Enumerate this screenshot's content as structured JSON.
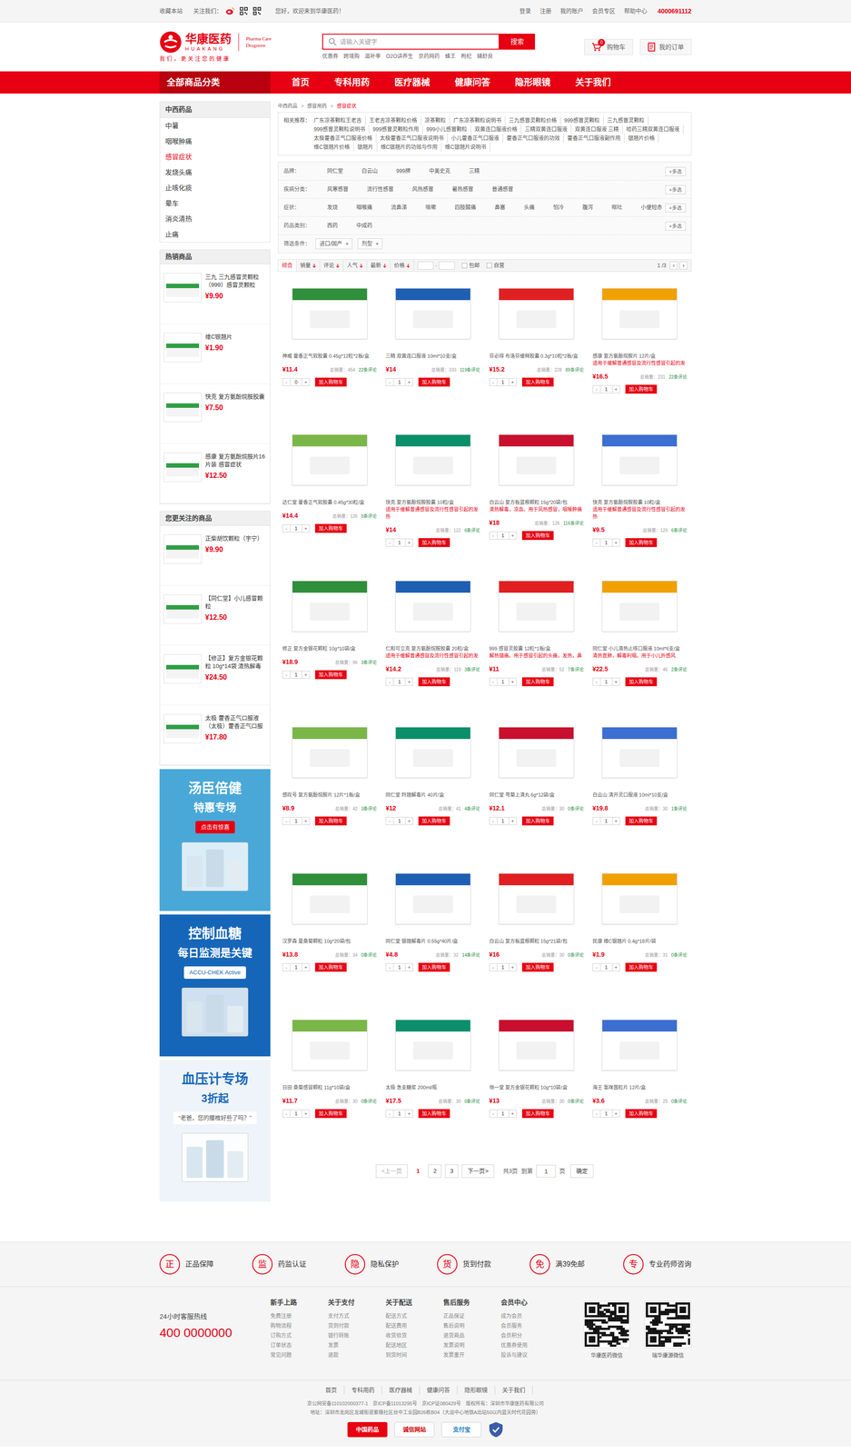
{
  "topbar": {
    "bookmark": "收藏本站",
    "follow": "关注我们：",
    "greeting": "您好，欢迎来到华康医药！",
    "links": [
      "登录",
      "注册",
      "我的账户",
      "会员专区",
      "帮助中心"
    ],
    "phone": "4000691112"
  },
  "logo": {
    "cn": "华康医药",
    "en": "HUAKANG",
    "tag1": "Pharma Care",
    "tag2": "Drugstore",
    "slogan": "我们，更关注您的健康"
  },
  "search": {
    "placeholder": "请输入关键字",
    "button": "搜索",
    "hot": [
      "优惠券",
      "跨境购",
      "滋补季",
      "O2O讲养生",
      "京药网药",
      "蜂王",
      "枸杞",
      "辅舒良"
    ]
  },
  "cart": {
    "label": "购物车",
    "count": "0"
  },
  "orders": {
    "label": "我的订单"
  },
  "nav": {
    "all": "全部商品分类",
    "items": [
      {
        "label": "首页",
        "selected": false
      },
      {
        "label": "专科用药",
        "selected": false
      },
      {
        "label": "医疗器械",
        "selected": false
      },
      {
        "label": "健康问答",
        "selected": false
      },
      {
        "label": "隐形眼镜",
        "selected": false
      },
      {
        "label": "关于我们",
        "selected": false
      }
    ]
  },
  "sidebar": {
    "category": {
      "title": "中西药品",
      "items": [
        {
          "label": "中暑",
          "selected": false
        },
        {
          "label": "咽喉肿痛",
          "selected": false
        },
        {
          "label": "感冒症状",
          "selected": true
        },
        {
          "label": "发烧头痛",
          "selected": false
        },
        {
          "label": "止咳化痰",
          "selected": false
        },
        {
          "label": "晕车",
          "selected": false
        },
        {
          "label": "消炎清热",
          "selected": false
        },
        {
          "label": "止痛",
          "selected": false
        }
      ]
    },
    "hot": {
      "title": "热销商品",
      "items": [
        {
          "name": "三九 三九感冒灵颗粒（999）感冒灵颗粒",
          "price": "¥9.90"
        },
        {
          "name": "维C银翘片",
          "price": "¥1.90"
        },
        {
          "name": "快克 复方氨酚烷胺胶囊",
          "price": "¥7.50"
        },
        {
          "name": "感康 复方氨酚烷胺片16片装 感冒症状",
          "price": "¥12.50"
        }
      ]
    },
    "care": {
      "title": "您更关注的商品",
      "items": [
        {
          "name": "正柴胡饮颗粒（宇宁）",
          "price": "¥9.90"
        },
        {
          "name": "【同仁堂】小儿感冒颗粒",
          "price": "¥12.50"
        },
        {
          "name": "【修正】复方金银花颗粒 10g*14袋 清热解毒",
          "price": "¥24.50"
        },
        {
          "name": "太极 藿香正气口服液（太极）藿香正气口服",
          "price": "¥17.80"
        }
      ]
    },
    "banners": [
      {
        "title": "汤臣倍健",
        "subtitle": "特惠专场",
        "action": "点击有惊喜"
      },
      {
        "title": "控制血糖",
        "subtitle": "每日监测是关键",
        "action": "ACCU-CHEK Active"
      },
      {
        "title": "血压计专场",
        "subtitle": "3折起",
        "action": "“老爸，您的腰椎好些了吗？”"
      }
    ]
  },
  "breadcrumb": {
    "items": [
      "中西药品",
      "感冒用药",
      "感冒症状"
    ],
    "sep": ">"
  },
  "related": {
    "label": "相关推荐：",
    "links": [
      "广东凉茶颗粒王老吉",
      "王老吉凉茶颗粒价格",
      "凉茶颗粒",
      "广东凉茶颗粒说明书",
      "三九感冒灵颗粒价格",
      "999感冒灵颗粒",
      "三九感冒灵颗粒",
      "999感冒灵颗粒说明书",
      "999感冒灵颗粒作用",
      "999小儿感冒颗粒",
      "双黄连口服液价格",
      "三精双黄连口服液",
      "双黄连口服液 三精",
      "哈药三精双黄连口服液",
      "太极藿香正气口服液价格",
      "太极藿香正气口服液说明书",
      "小儿藿香正气口服液",
      "藿香正气口服液的功效",
      "藿香正气口服液副作用",
      "银翘片价格",
      "维C银翘片价格",
      "银翘片",
      "维C银翘片的功效与作用",
      "维C银翘片说明书"
    ]
  },
  "filters": {
    "rows": [
      {
        "label": "品牌：",
        "options": [
          "同仁堂",
          "白云山",
          "999牌",
          "中美史克",
          "三精"
        ],
        "more": "+多选"
      },
      {
        "label": "疾病分类：",
        "options": [
          "风寒感冒",
          "流行性感冒",
          "风热感冒",
          "暑热感冒",
          "普通感冒"
        ],
        "more": "+多选"
      },
      {
        "label": "症状：",
        "options": [
          "发烧",
          "咽喉痛",
          "流鼻涕",
          "咳嗽",
          "四肢酸痛",
          "鼻塞",
          "头痛",
          "怕冷",
          "腹泻",
          "呕吐",
          "小便短赤"
        ],
        "more": "+多选"
      },
      {
        "label": "药品类别：",
        "options": [
          "西药",
          "中成药"
        ],
        "more": "+多选"
      }
    ],
    "conditions": {
      "label": "筛选条件：",
      "selects": [
        "进口/国产",
        "剂型"
      ],
      "arrow": "▾"
    }
  },
  "sort": {
    "items": [
      {
        "label": "综合",
        "selected": true
      },
      {
        "label": "销量",
        "selected": false
      },
      {
        "label": "评论",
        "selected": false
      },
      {
        "label": "人气",
        "selected": false
      },
      {
        "label": "最新",
        "selected": false
      },
      {
        "label": "价格",
        "selected": false
      }
    ],
    "range_sep": "-",
    "checks": [
      {
        "label": "包邮",
        "checked": false
      },
      {
        "label": "自营",
        "checked": false
      }
    ],
    "page": "1 /3",
    "prev": "‹",
    "next": "›"
  },
  "products": {
    "add": "加入购物车",
    "minus": "-",
    "plus": "+",
    "items": [
      {
        "name": "神威 藿香正气软胶囊 0.45g*12粒*2板/盒",
        "price": "¥11.4",
        "sales": "总销量：454",
        "reviews": "22条评论",
        "qty": "0"
      },
      {
        "name": "三精 双黄连口服液 10ml*10支/盒",
        "price": "¥14",
        "sales": "总销量：333",
        "reviews": "119条评论",
        "qty": "1"
      },
      {
        "name": "芬必得 布洛芬缓释胶囊 0.3g*10粒*2板/盒",
        "price": "¥15.2",
        "sales": "总销量：228",
        "reviews": "89条评论",
        "qty": "1"
      },
      {
        "name": "感康 复方氨酚烷胺片 12片/盒",
        "desc": "适用于缓解普通感冒及流行性感冒引起的发",
        "price": "¥16.5",
        "sales": "总销量：231",
        "reviews": "22条评论",
        "qty": "1"
      },
      {
        "name": "达仁堂 藿香正气软胶囊 0.45g*30粒/盒",
        "price": "¥14.4",
        "sales": "总销量：126",
        "reviews": "5条评论",
        "qty": "1"
      },
      {
        "name": "快克 复方氨酚烷胺胶囊 10粒/盒",
        "desc": "适用于缓解普通感冒及流行性感冒引起的发热",
        "price": "¥14",
        "sales": "总销量：122",
        "reviews": "6条评论",
        "qty": "1"
      },
      {
        "name": "白云山 复方板蓝根颗粒 15g*20袋/包",
        "desc": "清热解毒，凉血。用于风热感冒，咽喉肿痛",
        "price": "¥18",
        "sales": "总销量：126",
        "reviews": "116条评论",
        "qty": "1"
      },
      {
        "name": "快克 复方氨酚烷胺胶囊 10粒/盒",
        "desc": "适用于缓解普通感冒及流行性感冒引起的发热",
        "price": "¥9.5",
        "sales": "总销量：129",
        "reviews": "6条评论",
        "qty": "1"
      },
      {
        "name": "修正 复方金银花颗粒 10g*10袋/盒",
        "price": "¥18.9",
        "sales": "总销量：96",
        "reviews": "3条评论",
        "qty": "1"
      },
      {
        "name": "仁和可立克 复方氨酚烷胺胶囊 20粒/盒",
        "desc": "适用于缓解普通感冒及流行性感冒引起的发",
        "price": "¥14.2",
        "sales": "总销量：119",
        "reviews": "3条评论",
        "qty": "1"
      },
      {
        "name": "999 感冒灵胶囊 12粒*1板/盒",
        "desc": "解热镇痛。用于感冒引起的头痛，发热，鼻",
        "price": "¥11",
        "sales": "总销量：52",
        "reviews": "7条评论",
        "qty": "1"
      },
      {
        "name": "同仁堂 小儿清热止咳口服液 10ml*6支/盒",
        "desc": "清热宣肺，解毒利咽。用于小儿外感风",
        "price": "¥22.5",
        "sales": "总销量：46",
        "reviews": "2条评论",
        "qty": "1"
      },
      {
        "name": "感叹号 复方氨酚烷胺片 12片*1板/盒",
        "price": "¥8.9",
        "sales": "总销量：42",
        "reviews": "3条评论",
        "qty": "1"
      },
      {
        "name": "同仁堂 羚翘解毒片 40片/盒",
        "price": "¥12",
        "sales": "总销量：41",
        "reviews": "4条评论",
        "qty": "1"
      },
      {
        "name": "同仁堂 芎菊上清丸 6g*12袋/盒",
        "price": "¥12.1",
        "sales": "总销量：30",
        "reviews": "0条评论",
        "qty": "1"
      },
      {
        "name": "白云山 清开灵口服液 10ml*10支/盒",
        "price": "¥19.8",
        "sales": "总销量：30",
        "reviews": "1条评论",
        "qty": "1"
      },
      {
        "name": "汉罗森 夏桑菊颗粒 10g*20袋/包",
        "price": "¥13.8",
        "sales": "总销量：34",
        "reviews": "0条评论",
        "qty": "1"
      },
      {
        "name": "同仁堂 银翘解毒片 0.55g*40片/盒",
        "price": "¥4.8",
        "sales": "总销量：32",
        "reviews": "14条评论",
        "qty": "1"
      },
      {
        "name": "白云山 复方板蓝根颗粒 15g*21袋/包",
        "price": "¥16",
        "sales": "总销量：30",
        "reviews": "0条评论",
        "qty": "1"
      },
      {
        "name": "民康 维C银翘片 0.4g*18片/袋",
        "price": "¥1.9",
        "sales": "总销量：31",
        "reviews": "0条评论",
        "qty": "1"
      },
      {
        "name": "日田 桑菊感冒颗粒 11g*10袋/盒",
        "price": "¥11.7",
        "sales": "总销量：30",
        "reviews": "0条评论",
        "qty": "1"
      },
      {
        "name": "太极 急支糖浆 200ml/瓶",
        "price": "¥17.5",
        "sales": "总销量：30",
        "reviews": "0条评论",
        "qty": "1"
      },
      {
        "name": "恒一堂 复方金银花颗粒 10g*10袋/盒",
        "price": "¥13",
        "sales": "总销量：30",
        "reviews": "0条评论",
        "qty": "1"
      },
      {
        "name": "海王 氯咪茵粒片 12片/盒",
        "price": "¥3.6",
        "sales": "总销量：25",
        "reviews": "0条评论",
        "qty": "1"
      }
    ]
  },
  "pagination": {
    "prev": {
      "label": "<上一页",
      "disabled": true
    },
    "pages": [
      {
        "label": "1",
        "selected": true
      },
      {
        "label": "2",
        "selected": false
      },
      {
        "label": "3",
        "selected": false
      }
    ],
    "next": {
      "label": "下一页>",
      "disabled": false
    },
    "total": "共3页",
    "goto": "到第",
    "value": "1",
    "unit": "页",
    "confirm": "确定"
  },
  "guarantees": [
    {
      "icon": "正",
      "label": "正品保障"
    },
    {
      "icon": "监",
      "label": "药监认证"
    },
    {
      "icon": "隐",
      "label": "隐私保护"
    },
    {
      "icon": "货",
      "label": "货到付款"
    },
    {
      "icon": "免",
      "label": "满39免邮"
    },
    {
      "icon": "专",
      "label": "专业药师咨询"
    }
  ],
  "footer": {
    "hotline_label": "24小时客服热线",
    "hotline": "400 0000000",
    "columns": [
      {
        "title": "新手上路",
        "links": [
          "免费注册",
          "购物流程",
          "订购方式",
          "订单状态",
          "常见问题"
        ]
      },
      {
        "title": "关于支付",
        "links": [
          "支付方式",
          "货到付款",
          "银行转账",
          "发票",
          "退款"
        ]
      },
      {
        "title": "关于配送",
        "links": [
          "配送方式",
          "配送费用",
          "收货验货",
          "配送地区",
          "到货时间"
        ]
      },
      {
        "title": "售后服务",
        "links": [
          "正品保证",
          "售后说明",
          "退货商品",
          "发票说明",
          "发票重开"
        ]
      },
      {
        "title": "会员中心",
        "links": [
          "成为会员",
          "会员服务",
          "会员积分",
          "优惠券使用",
          "投诉与建议"
        ]
      }
    ],
    "qrs": [
      "华康医药微信",
      "瑞华康源微信"
    ],
    "links": [
      "首页",
      "专科用药",
      "医疗器械",
      "健康问答",
      "隐形眼镜",
      "关于我们"
    ],
    "icp": "京公网安备110102000377-1　京ICP备11013295号　京ICP证080429号　版权所有：深圳市华康医药有限公司",
    "address": "地址：深圳市龙岗区龙城街道紫薇社区台中工业园B26栋B04（大运中心地铁A出站50以内蓝天时代花园旁）",
    "badges": [
      "中国药品",
      "诚信网站",
      "支付宝"
    ]
  }
}
